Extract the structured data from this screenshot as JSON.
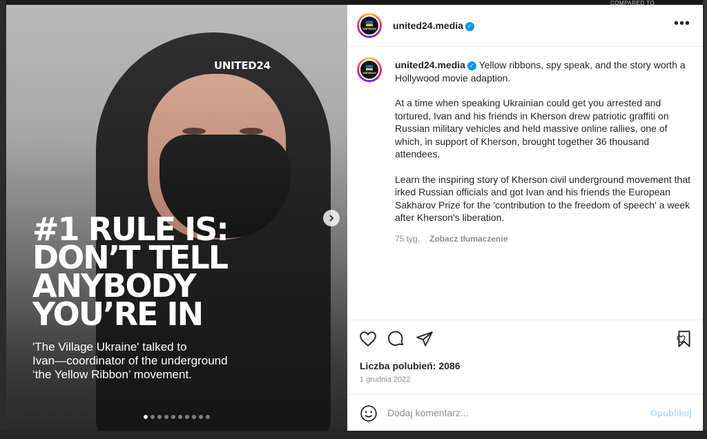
{
  "background": {
    "top_label": "COMPARED TO"
  },
  "media": {
    "brand_logo": "UNITED24",
    "headline": "#1 RULE IS:\nDON’T TELL\nANYBODY\nYOU’RE IN",
    "subtext": "'The Village Ukraine' talked to\nIvan—coordinator of the underground\n‘the Yellow Ribbon’ movement.",
    "slide_count": 10,
    "active_slide": 1
  },
  "header": {
    "username": "united24.media",
    "avatar_word": "UNITED24"
  },
  "caption": {
    "username": "united24.media",
    "intro": "Yellow ribbons, spy speak, and the story worth a Hollywood movie adaption.",
    "paragraph2": "At a time when speaking Ukrainian could get you arrested and tortured, Ivan and his friends in Kherson drew patriotic graffiti on Russian military vehicles and held massive online rallies, one of which, in support of Kherson, brought together 36 thousand attendees.",
    "paragraph3": "Learn the inspiring story of Kherson civil underground movement that irked Russian officials and got Ivan and his friends the European Sakharov Prize for the 'contribution to the freedom of speech' a week after Kherson's liberation.",
    "age": "75 tyg.",
    "translate_label": "Zobacz tłumaczenie"
  },
  "actions": {
    "likes": "Liczba polubień: 2086",
    "date": "1 grudnia 2022"
  },
  "comment": {
    "placeholder": "Dodaj komentarz...",
    "post_label": "Opublikuj"
  },
  "colors": {
    "verified": "#0095f6",
    "post_button": "#b2dffc"
  }
}
